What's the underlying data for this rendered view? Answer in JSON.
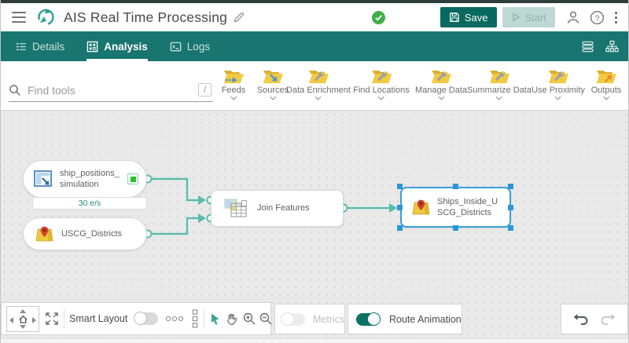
{
  "header": {
    "title": "AIS Real Time Processing",
    "save": "Save",
    "start": "Start"
  },
  "tabs": {
    "details": "Details",
    "analysis": "Analysis",
    "logs": "Logs"
  },
  "toolbox": {
    "search_placeholder": "Find tools",
    "search_shortcut": "/",
    "categories": [
      {
        "label": "Feeds"
      },
      {
        "label": "Sources"
      },
      {
        "label": "Data Enrichment"
      },
      {
        "label": "Find Locations"
      },
      {
        "label": "Manage Data"
      },
      {
        "label": "Summarize Data"
      },
      {
        "label": "Use Proximity"
      },
      {
        "label": "Outputs"
      }
    ]
  },
  "canvas": {
    "nodes": {
      "feed": {
        "label": "ship_positions_simulation",
        "rate": "30 e/s",
        "status": "running"
      },
      "source": {
        "label": "USCG_Districts"
      },
      "tool": {
        "label": "Join Features"
      },
      "output": {
        "label": "Ships_Inside_USCG_Districts",
        "selected": true
      }
    }
  },
  "footer": {
    "smart_layout": "Smart Layout",
    "metrics": "Metrics",
    "route_animation": "Route Animation",
    "collapse": "<",
    "smart_layout_on": false,
    "metrics_on": false,
    "route_animation_on": true
  },
  "colors": {
    "teal_bar": "#19756f",
    "save_button": "#07695f",
    "accent": "#2aa193",
    "connection": "#57bcab",
    "selection_blue": "#3a9fdc",
    "status_green": "#29c129",
    "folder_yellow": "#f2ca41"
  }
}
